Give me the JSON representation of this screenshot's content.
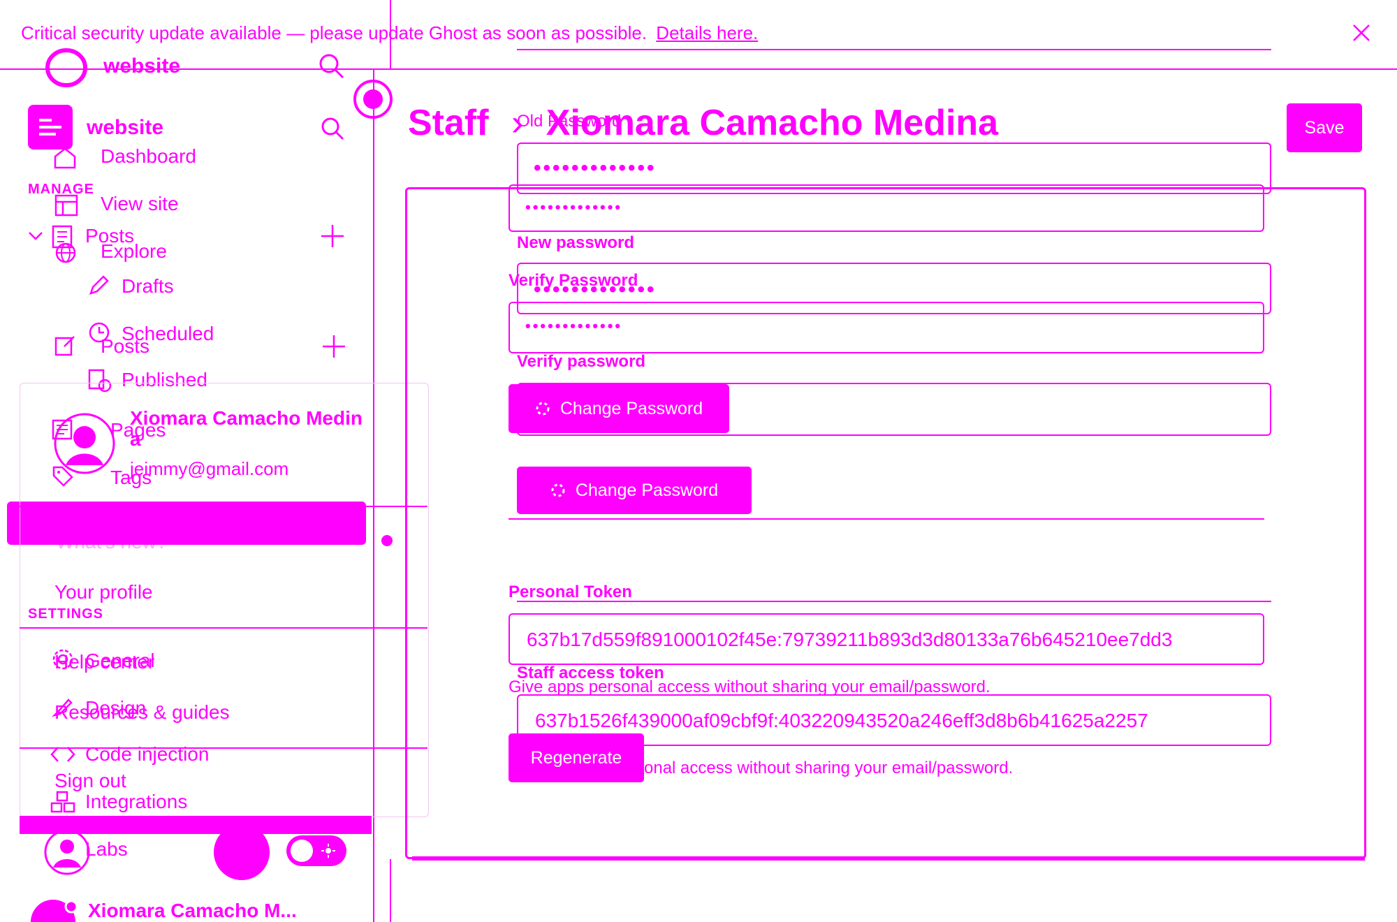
{
  "banner": {
    "message": "Critical security update available — please update Ghost as soon as possible.",
    "link": "Details here."
  },
  "sidebar": {
    "site_name": "website",
    "site_name_2": "website",
    "sections": {
      "manage": "MANAGE",
      "settings": "SETTINGS"
    },
    "items": {
      "dashboard": "Dashboard",
      "view_site": "View site",
      "explore": "Explore",
      "posts": "Posts",
      "posts_2": "Posts",
      "drafts": "Drafts",
      "scheduled": "Scheduled",
      "published": "Published",
      "pages": "Pages",
      "tags": "Tags",
      "general": "General",
      "design": "Design",
      "code_injection": "Code injection",
      "integrations": "Integrations",
      "labs": "Labs"
    },
    "footer_user": "Xiomara Camacho M..."
  },
  "user_menu": {
    "name_line1": "Xiomara Camacho Medin",
    "name_line2": "a",
    "email": "jeimmy@gmail.com",
    "whats_new": "What's new?",
    "your_profile": "Your profile",
    "help_center": "Help center",
    "resources": "Resources & guides",
    "sign_out": "Sign out"
  },
  "header": {
    "breadcrumb_root": "Staff",
    "separator": "›",
    "title": "Xiomara Camacho Medina",
    "save": "Save"
  },
  "password": {
    "old_label": "Old Password",
    "old_value": "•••••••••••••",
    "old_value_2": "•••••••••••••",
    "new_label": "New password",
    "verify_label_1": "Verify Password",
    "new_value": "•••••••••••••",
    "verify_value": "•••••••••••••",
    "verify_label_2": "Verify password",
    "change_btn_1": "Change Password",
    "change_btn_2": "Change Password"
  },
  "token": {
    "label": "Personal Token",
    "value_1": "637b17d559f891000102f45e:79739211b893d3d80133a76b645210ee7dd3",
    "label_2": "Staff access token",
    "help_1": "Give apps personal access without sharing your email/password.",
    "value_2": "637b1526f439000af09cbf9f:403220943520a246eff3d8b6b41625a2257",
    "regenerate": "Regenerate",
    "help_2": "onal access without sharing your email/password."
  },
  "colors": {
    "accent": "#ff00ff",
    "background": "#ffffff"
  }
}
